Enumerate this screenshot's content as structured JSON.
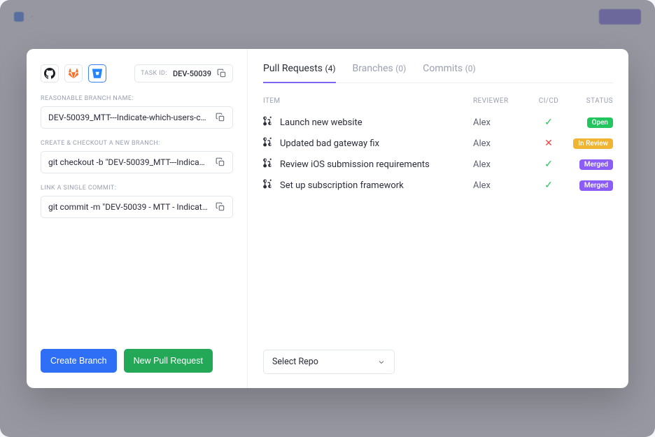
{
  "task_id": {
    "label": "TASK ID:",
    "value": "DEV-50039"
  },
  "fields": {
    "branch": {
      "label": "REASONABLE BRANCH NAME:",
      "value": "DEV-50039_MTT---Indicate-which-users-c…"
    },
    "checkout": {
      "label": "CREATE & CHECKOUT A NEW BRANCH:",
      "value": "git checkout -b \"DEV-50039_MTT---Indica…"
    },
    "commit": {
      "label": "LINK A SINGLE COMMIT:",
      "value": "git commit -m \"DEV-50039 - MTT - Indicat…"
    }
  },
  "buttons": {
    "create_branch": "Create Branch",
    "new_pr": "New Pull Request"
  },
  "tabs": {
    "pull_requests": {
      "label": "Pull Requests",
      "count": "(4)"
    },
    "branches": {
      "label": "Branches",
      "count": "(0)"
    },
    "commits": {
      "label": "Commits",
      "count": "(0)"
    }
  },
  "columns": {
    "item": "ITEM",
    "reviewer": "REVIEWER",
    "cicd": "CI/CD",
    "status": "STATUS"
  },
  "pull_requests": [
    {
      "name": "Launch new website",
      "reviewer": "Alex",
      "ci": "ok",
      "status": "Open",
      "status_class": "badge-open"
    },
    {
      "name": "Updated bad gateway fix",
      "reviewer": "Alex",
      "ci": "fail",
      "status": "In Review",
      "status_class": "badge-review"
    },
    {
      "name": "Review iOS submission requirements",
      "reviewer": "Alex",
      "ci": "ok",
      "status": "Merged",
      "status_class": "badge-merged"
    },
    {
      "name": "Set up subscription framework",
      "reviewer": "Alex",
      "ci": "ok",
      "status": "Merged",
      "status_class": "badge-merged"
    }
  ],
  "select_repo": "Select Repo"
}
